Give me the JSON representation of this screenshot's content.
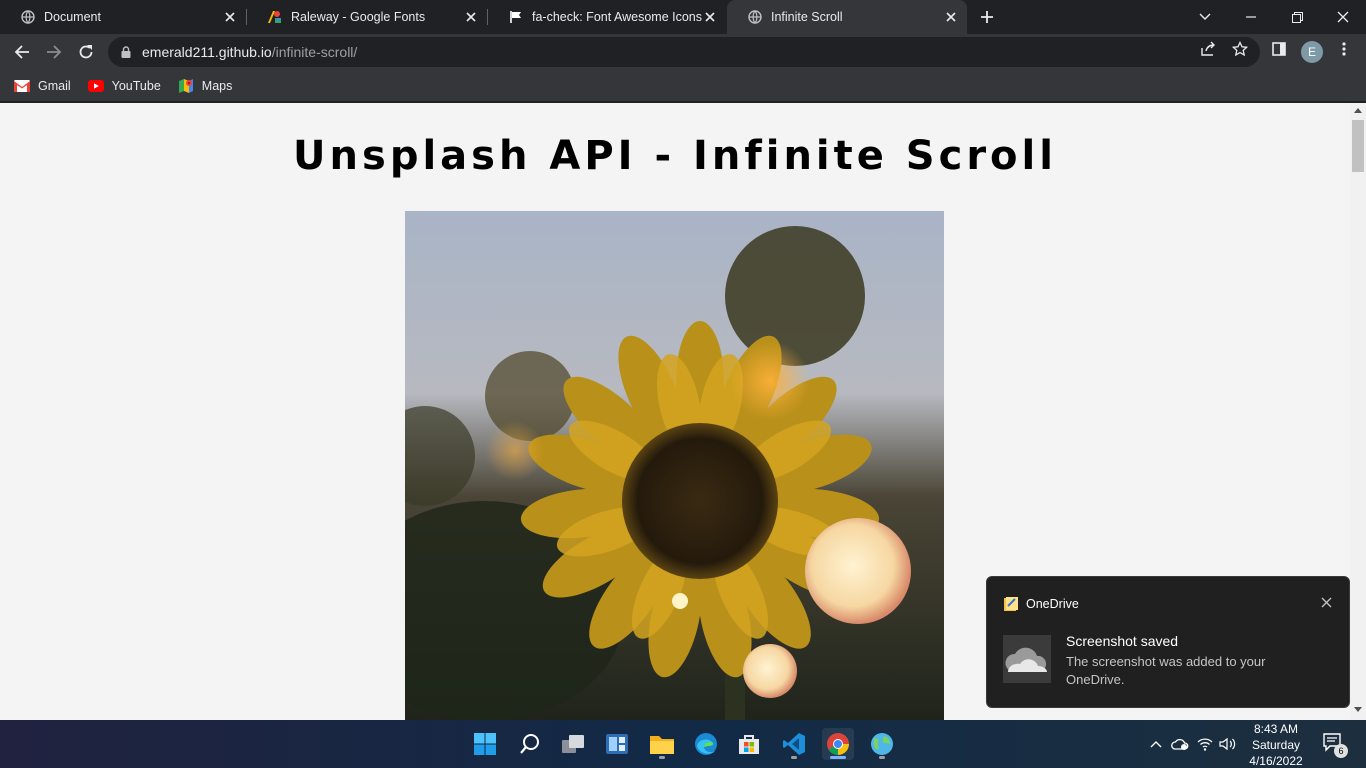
{
  "tabs": [
    {
      "title": "Document",
      "icon": "globe-icon",
      "active": false
    },
    {
      "title": "Raleway - Google Fonts",
      "icon": "google-fonts-icon",
      "active": false
    },
    {
      "title": "fa-check: Font Awesome Icons",
      "icon": "flag-icon",
      "active": false
    },
    {
      "title": "Infinite Scroll",
      "icon": "globe-icon",
      "active": true
    }
  ],
  "address": {
    "host": "emerald211.github.io",
    "path": "/infinite-scroll/"
  },
  "profile": {
    "initial": "E"
  },
  "bookmarks": [
    {
      "label": "Gmail",
      "icon": "gmail-icon"
    },
    {
      "label": "YouTube",
      "icon": "youtube-icon"
    },
    {
      "label": "Maps",
      "icon": "maps-icon"
    }
  ],
  "page": {
    "heading": "Unsplash API - Infinite Scroll"
  },
  "toast": {
    "app": "OneDrive",
    "title": "Screenshot saved",
    "body": "The screenshot was added to your OneDrive."
  },
  "clock": {
    "time": "8:43 AM",
    "day": "Saturday",
    "date": "4/16/2022"
  },
  "notifications": {
    "count": "6"
  },
  "colors": {
    "chrome_dark": "#202124",
    "chrome_toolbar": "#35363a",
    "page_bg": "#f4f4f4",
    "accent": "#7ab4ff"
  }
}
